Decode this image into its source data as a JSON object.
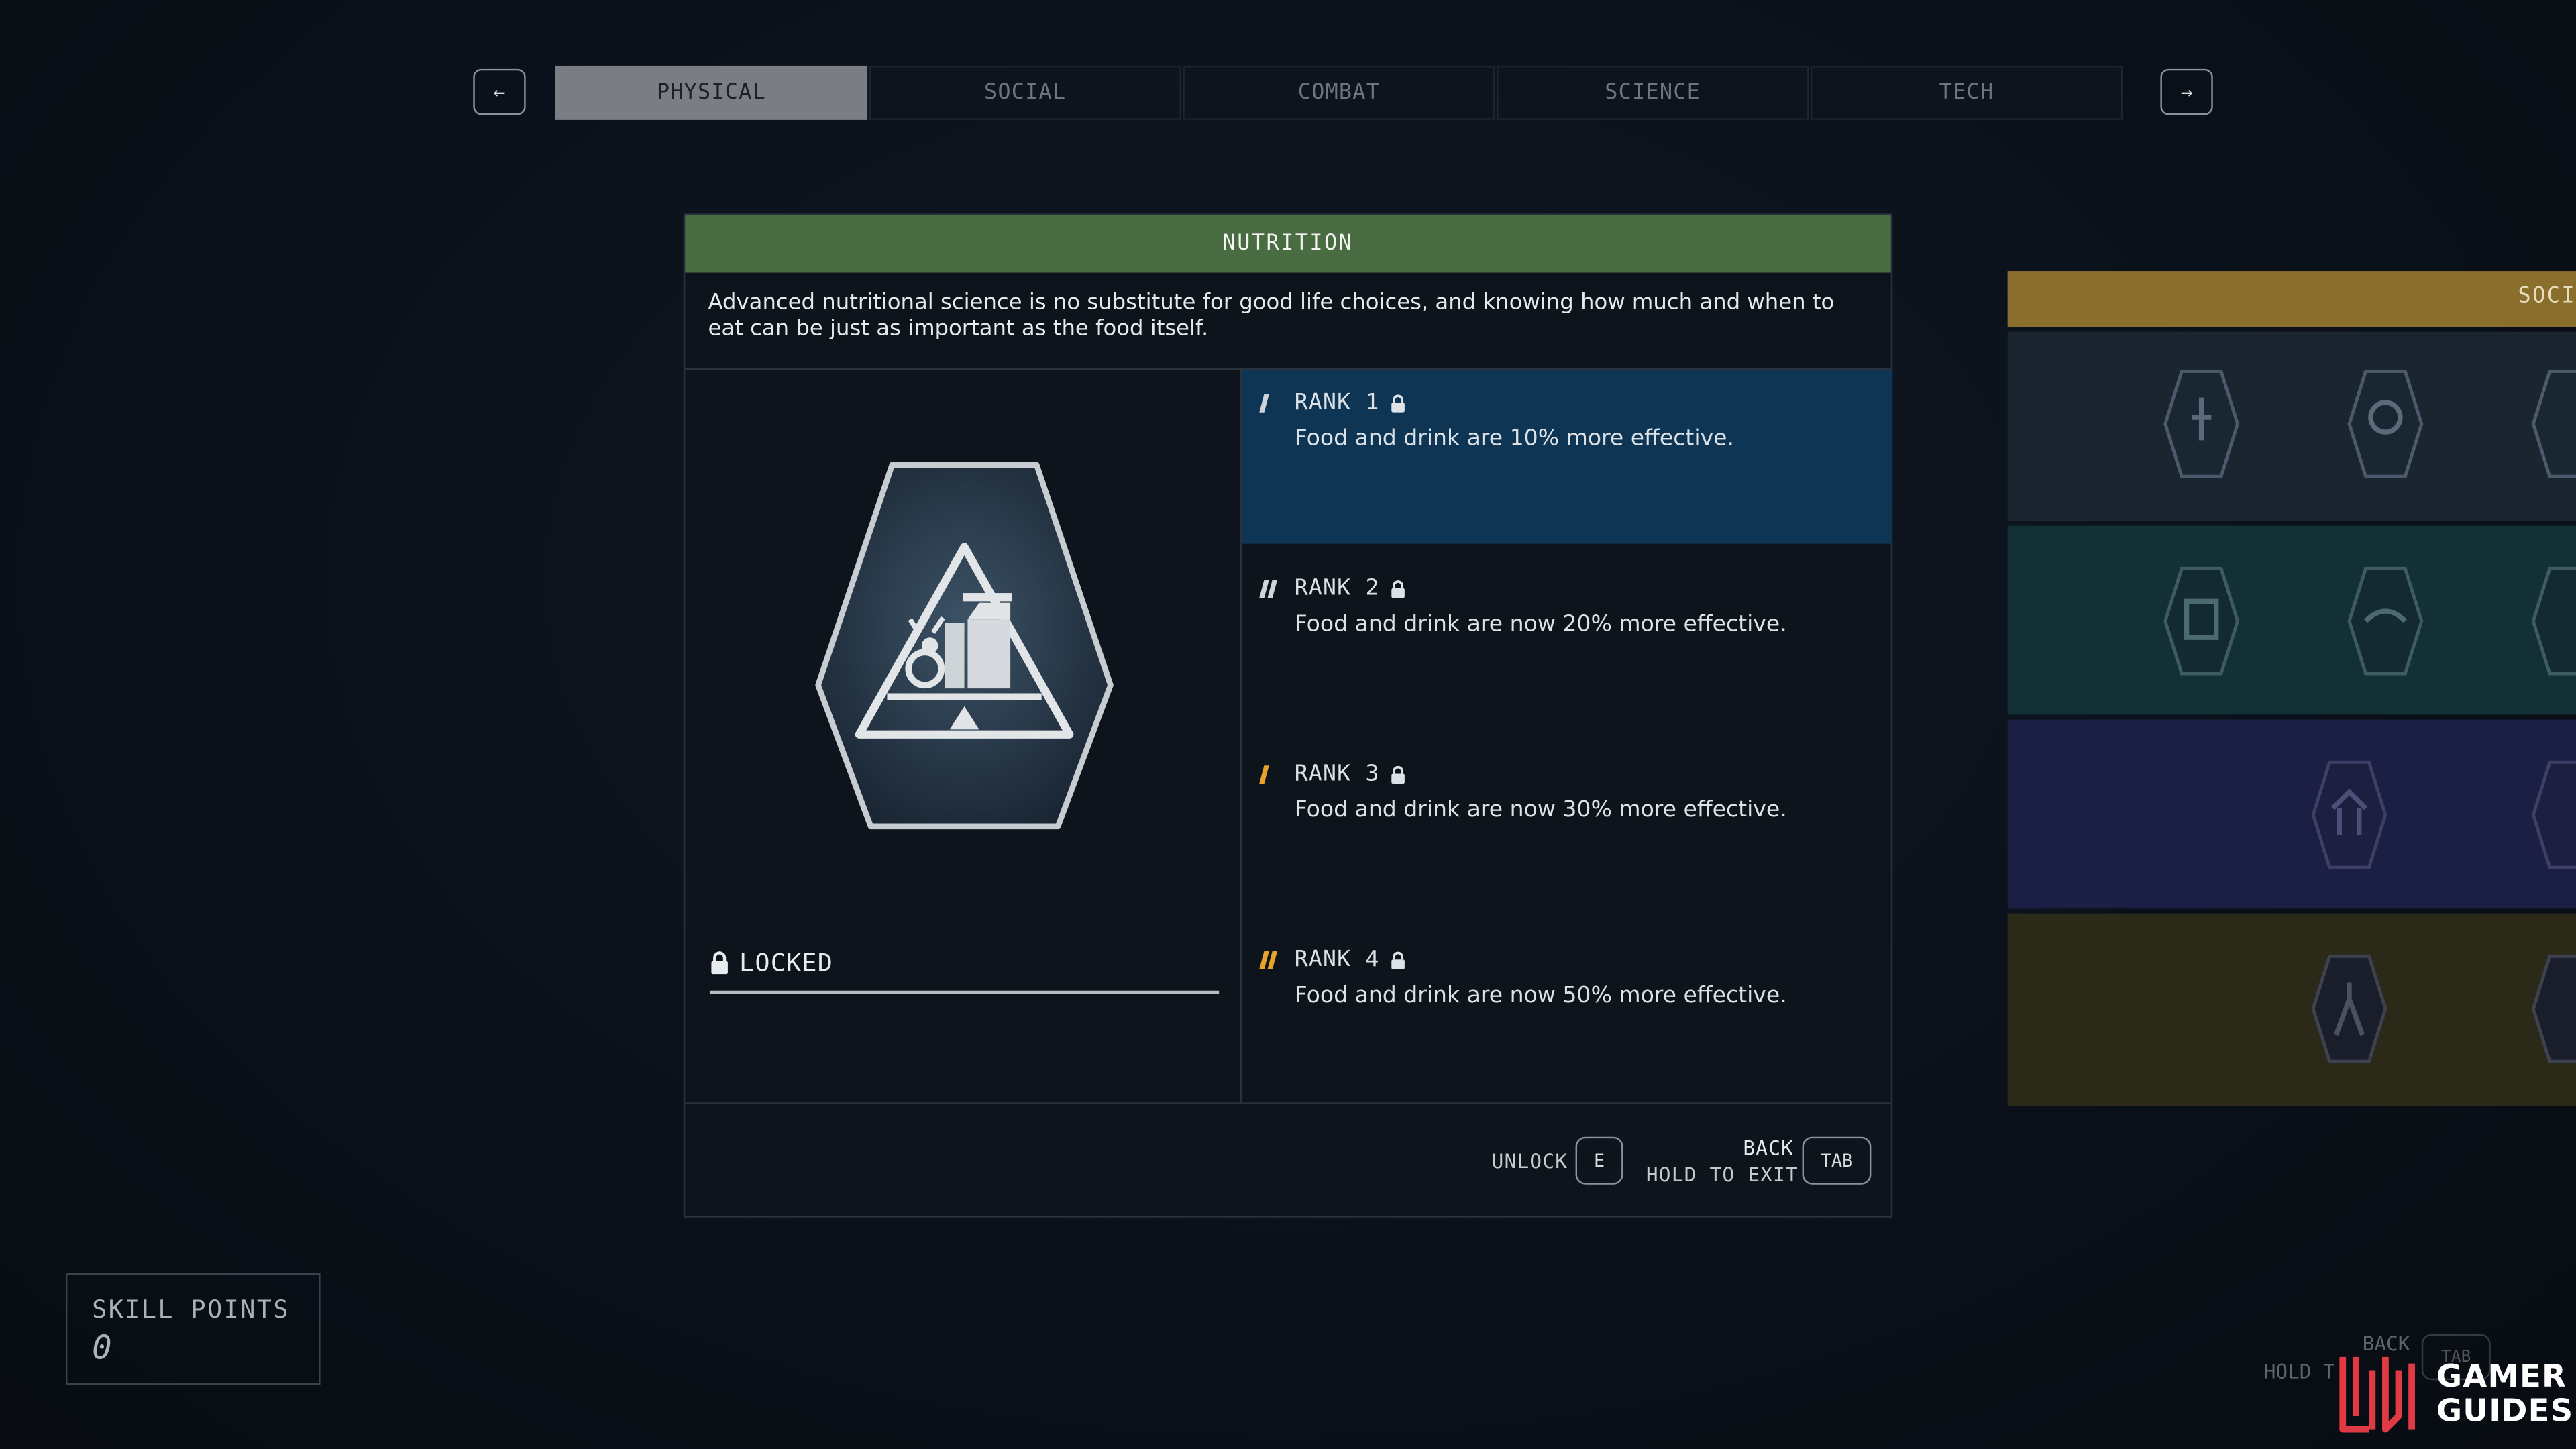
{
  "nav": {
    "prev_glyph": "←",
    "next_glyph": "→",
    "tabs": [
      {
        "label": "PHYSICAL",
        "active": true
      },
      {
        "label": "SOCIAL",
        "active": false
      },
      {
        "label": "COMBAT",
        "active": false
      },
      {
        "label": "SCIENCE",
        "active": false
      },
      {
        "label": "TECH",
        "active": false
      }
    ]
  },
  "skill": {
    "title": "NUTRITION",
    "header_color": "#4a6c42",
    "description": "Advanced nutritional science is no substitute for good life choices, and knowing how much and when to eat can be just as important as the food itself.",
    "status": "LOCKED",
    "badge_icon": "nutrition-badge-icon",
    "ranks": [
      {
        "title": "RANK 1",
        "description": "Food and drink are 10% more effective.",
        "selected": true,
        "tier_color": "#d0d4d8"
      },
      {
        "title": "RANK 2",
        "description": "Food and drink are now 20% more effective.",
        "selected": false,
        "tier_color": "#d0d4d8"
      },
      {
        "title": "RANK 3",
        "description": "Food and drink are now 30% more effective.",
        "selected": false,
        "tier_color": "#e6a42a"
      },
      {
        "title": "RANK 4",
        "description": "Food and drink are now 50% more effective.",
        "selected": false,
        "tier_color": "#e6a42a"
      }
    ]
  },
  "footer": {
    "unlock_label": "UNLOCK",
    "unlock_key": "E",
    "back_label": "BACK",
    "hold_label": "HOLD TO EXIT",
    "back_key": "TAB"
  },
  "skill_points": {
    "label": "SKILL POINTS",
    "value": "0"
  },
  "side_panel": {
    "header_label": "SOCI"
  },
  "ghost_hints": {
    "back": "BACK",
    "hold": "HOLD T",
    "key": "TAB"
  },
  "watermark": {
    "line1": "GAMER",
    "line2": "GUIDES",
    "logo_color": "#e03a45"
  }
}
